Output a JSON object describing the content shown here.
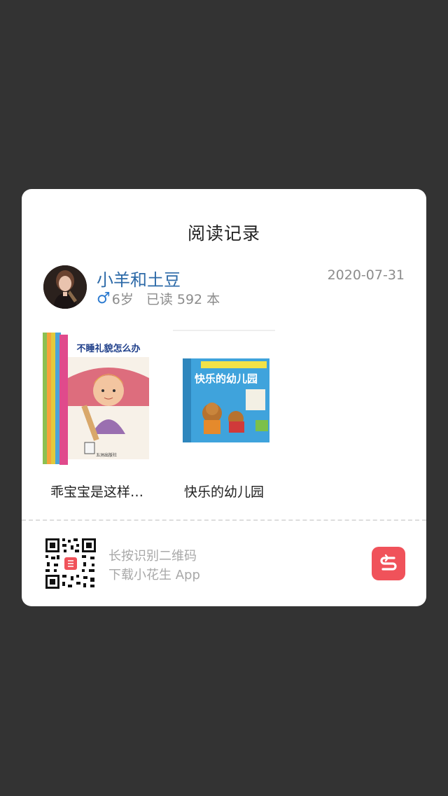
{
  "modal": {
    "title": "阅读记录",
    "user": {
      "name": "小羊和土豆",
      "gender_symbol": "♂",
      "age": "6岁",
      "read_count": "已读 592 本",
      "date": "2020-07-31"
    },
    "books": [
      {
        "title": "乖宝宝是这样…",
        "cover_text": "不睡礼貌怎么办"
      },
      {
        "title": "快乐的幼儿园",
        "cover_text": "快乐的幼儿园"
      }
    ],
    "footer": {
      "line1": "长按识别二维码",
      "line2": "下载小花生 App"
    }
  },
  "colors": {
    "backdrop": "#333333",
    "username": "#2d6aa8",
    "gender": "#2d7bd0",
    "logo": "#f0525a"
  }
}
